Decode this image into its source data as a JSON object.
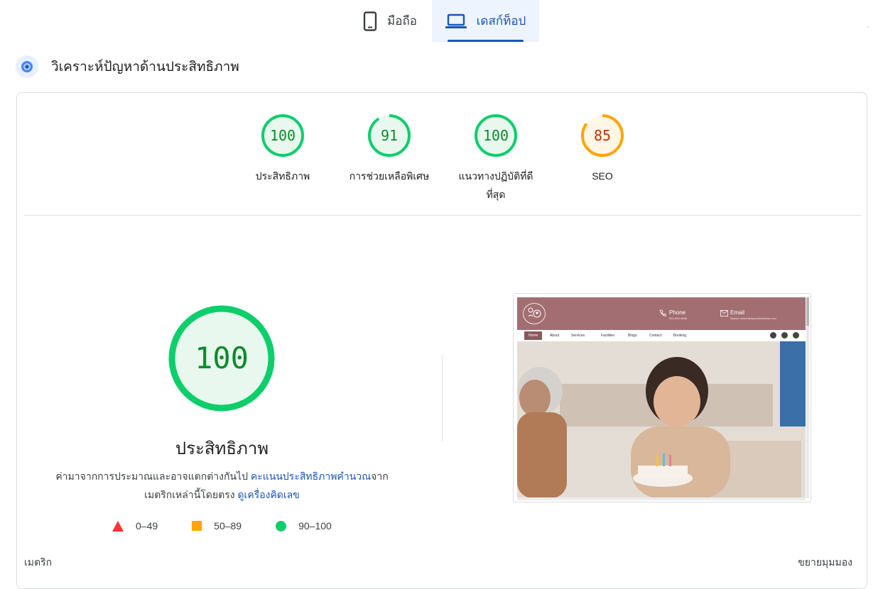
{
  "tabs": {
    "mobile_label": "มือถือ",
    "desktop_label": "เดสก์ท็อป",
    "active": "desktop"
  },
  "header": {
    "title": "วิเคราะห์ปัญหาด้านประสิทธิภาพ"
  },
  "scores": [
    {
      "value": "100",
      "label": "ประสิทธิภาพ",
      "status": "pass",
      "fraction": 1.0
    },
    {
      "value": "91",
      "label": "การช่วยเหลือพิเศษ",
      "status": "pass",
      "fraction": 0.91
    },
    {
      "value": "100",
      "label": "แนวทางปฏิบัติที่ดีที่สุด",
      "status": "pass",
      "fraction": 1.0
    },
    {
      "value": "85",
      "label": "SEO",
      "status": "average",
      "fraction": 0.85
    }
  ],
  "performance": {
    "score": "100",
    "title": "ประสิทธิภาพ",
    "desc_text_1": "ค่ามาจากการประมาณและอาจแตกต่างกันไป ",
    "desc_link_1": "คะแนนประสิทธิภาพคำนวณ",
    "desc_text_2": "จากเมตริกเหล่านี้โดยตรง ",
    "desc_link_2": "ดูเครื่องคิดเลข"
  },
  "legend": {
    "fail": "0–49",
    "average": "50–89",
    "pass": "90–100"
  },
  "footer": {
    "metrics_label": "เมตริก",
    "expand_label": "ขยายมุมมอง"
  },
  "screenshot": {
    "phone_label": "Phone",
    "phone_value": "081-083-4556",
    "email_label": "Email",
    "email_value": "Nymph.centre@nymphwellness.com",
    "nav": [
      "Home",
      "About",
      "Services",
      "Facilities",
      "Blogs",
      "Contact",
      "Booking"
    ]
  },
  "colors": {
    "pass": "#0cce6b",
    "average": "#ffa400",
    "fail": "#ff3333",
    "accent": "#1a56b5"
  }
}
